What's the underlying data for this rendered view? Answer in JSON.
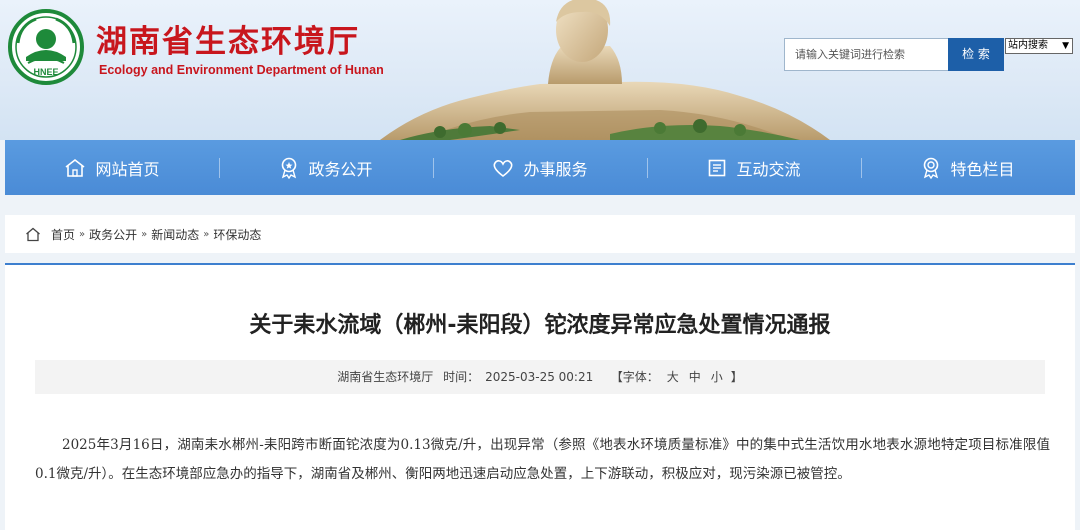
{
  "header": {
    "org_name_cn": "湖南省生态环境厅",
    "org_name_en": "Ecology and Environment Department of Hunan",
    "logo_text": "HNEE"
  },
  "search": {
    "placeholder": "请输入关键词进行检索",
    "button_label": "检 索",
    "scope_selected": "站内搜索"
  },
  "nav": {
    "items": [
      {
        "label": "网站首页",
        "icon": "home-icon"
      },
      {
        "label": "政务公开",
        "icon": "badge-icon"
      },
      {
        "label": "办事服务",
        "icon": "heart-icon"
      },
      {
        "label": "互动交流",
        "icon": "document-icon"
      },
      {
        "label": "特色栏目",
        "icon": "award-icon"
      }
    ]
  },
  "breadcrumb": {
    "items": [
      "首页",
      "政务公开",
      "新闻动态",
      "环保动态"
    ],
    "separator": "»"
  },
  "article": {
    "title": "关于耒水流域（郴州-耒阳段）铊浓度异常应急处置情况通报",
    "source": "湖南省生态环境厅",
    "time_label": "时间：",
    "time": "2025-03-25 00:21",
    "font_size_label": "【字体：",
    "font_large": "大",
    "font_medium": "中",
    "font_small": "小",
    "font_size_close": "】",
    "body": "2025年3月16日，湖南耒水郴州-耒阳跨市断面铊浓度为0.13微克/升，出现异常（参照《地表水环境质量标准》中的集中式生活饮用水地表水源地特定项目标准限值0.1微克/升）。在生态环境部应急办的指导下，湖南省及郴州、衡阳两地迅速启动应急处置，上下游联动，积极应对，现污染源已被管控。"
  },
  "colors": {
    "brand_red": "#c8161d",
    "nav_blue": "#4a8bd6",
    "button_blue": "#1d5fa8",
    "logo_green": "#1e8a3a"
  }
}
